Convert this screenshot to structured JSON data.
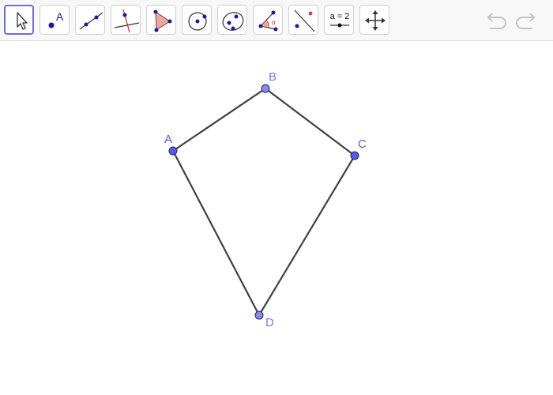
{
  "toolbar": {
    "tools": [
      {
        "id": "move",
        "icon": "move-arrow-icon"
      },
      {
        "id": "point",
        "icon": "point-icon",
        "label": "A"
      },
      {
        "id": "line",
        "icon": "line-icon"
      },
      {
        "id": "perpendicular",
        "icon": "perpendicular-line-icon"
      },
      {
        "id": "polygon",
        "icon": "polygon-icon"
      },
      {
        "id": "circle",
        "icon": "circle-center-point-icon"
      },
      {
        "id": "ellipse",
        "icon": "ellipse-icon"
      },
      {
        "id": "angle",
        "icon": "angle-icon",
        "label": "α"
      },
      {
        "id": "reflect",
        "icon": "reflect-line-icon"
      },
      {
        "id": "slider",
        "icon": "slider-icon",
        "label": "a = 2"
      },
      {
        "id": "move-view",
        "icon": "move-graphics-view-icon"
      }
    ],
    "undo_icon": "undo-icon",
    "redo_icon": "redo-icon"
  },
  "colors": {
    "point_fill": "#7b7bea",
    "point_stroke": "#333399",
    "segment": "#404040",
    "label": "#6a6ae0",
    "selected_border": "#6d6dd6"
  },
  "points": [
    {
      "name": "A"
    },
    {
      "name": "B"
    },
    {
      "name": "C"
    },
    {
      "name": "D"
    }
  ]
}
